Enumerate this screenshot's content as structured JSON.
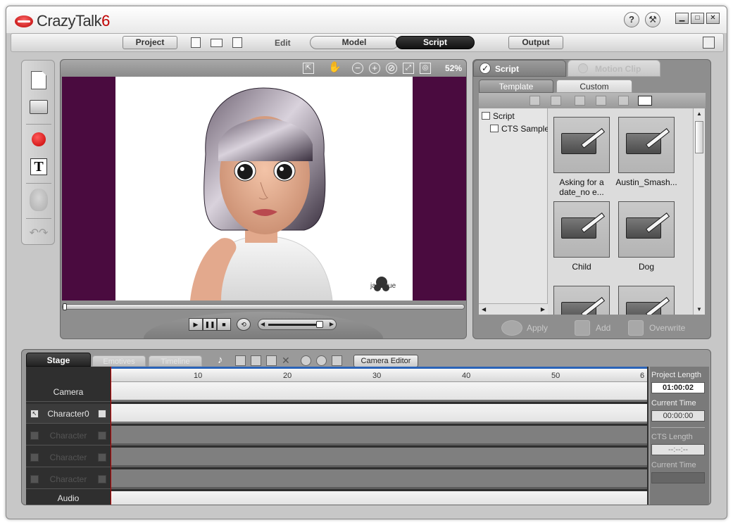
{
  "app": {
    "logo_text": "CrazyTalk",
    "logo_version": "6"
  },
  "titlebar": {
    "help_icon": "?",
    "window_buttons": [
      "▁",
      "□",
      "✕"
    ]
  },
  "menu": {
    "project": "Project",
    "edit": "Edit",
    "model": "Model",
    "script": "Script",
    "output": "Output"
  },
  "preview": {
    "zoom": "52%",
    "watermark": "janillyue"
  },
  "right_panel": {
    "tab_script": "Script",
    "tab_motion_clip": "Motion Clip",
    "subtab_template": "Template",
    "subtab_custom": "Custom",
    "tree": [
      {
        "label": "Script"
      },
      {
        "label": "CTS Sample"
      }
    ],
    "items": [
      {
        "label": "Asking for a date_no e..."
      },
      {
        "label": "Austin_Smash..."
      },
      {
        "label": "Child"
      },
      {
        "label": "Dog"
      }
    ],
    "actions": {
      "apply": "Apply",
      "add": "Add",
      "overwrite": "Overwrite"
    }
  },
  "timeline": {
    "tab_stage": "Stage",
    "tab_emotives": "Emotives",
    "tab_timeline": "Timeline",
    "camera_editor": "Camera Editor",
    "ruler_ticks": [
      "10",
      "20",
      "30",
      "40",
      "50",
      "6"
    ],
    "tracks": [
      "Camera",
      "Character0",
      "Character",
      "Character",
      "Character",
      "Audio"
    ],
    "info": {
      "project_length_label": "Project Length",
      "project_length_value": "01:00:02",
      "current_time_label": "Current Time",
      "current_time_value": "00:00:00",
      "cts_length_label": "CTS Length",
      "cts_length_value": "--:--:--",
      "current_time_label_2": "Current Time"
    }
  },
  "colors": {
    "stage_background": "#4a0b3f",
    "record": "#c40000",
    "playhead": "#c40000"
  }
}
